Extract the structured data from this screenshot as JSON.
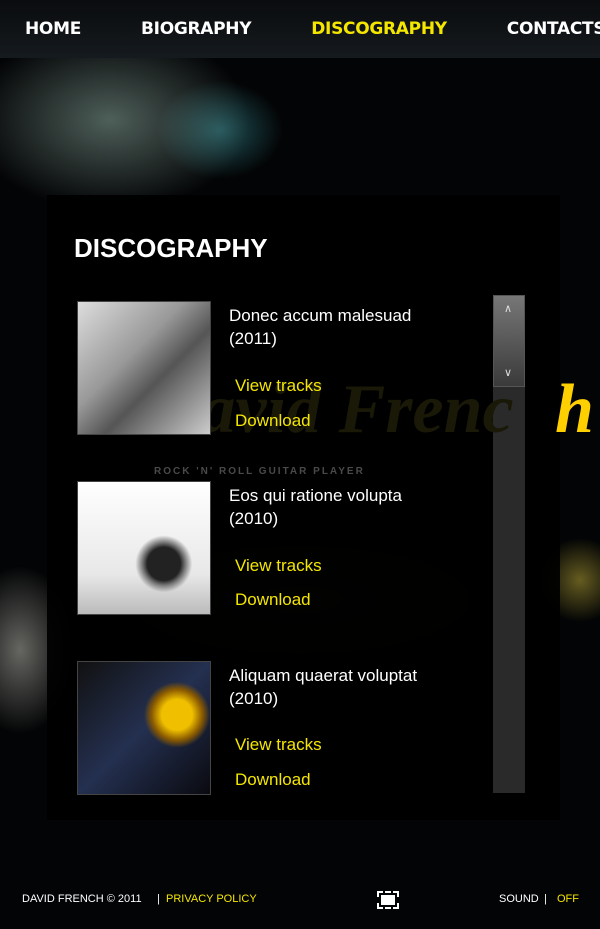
{
  "nav": {
    "items": [
      {
        "label": "HOME"
      },
      {
        "label": "BIOGRAPHY"
      },
      {
        "label": "DISCOGRAPHY",
        "active": true
      },
      {
        "label": "CONTACTS"
      }
    ]
  },
  "logo": {
    "text": "David French",
    "tagline": "ROCK 'N' ROLL GUITAR PLAYER"
  },
  "page": {
    "title": "DISCOGRAPHY"
  },
  "albums": [
    {
      "title": "Donec accum malesuad",
      "year": "(2011)",
      "view": "View tracks",
      "download": "Download",
      "image": "guitar-sheet-music"
    },
    {
      "title": "Eos qui ratione volupta",
      "year": "(2010)",
      "view": "View tracks",
      "download": "Download",
      "image": "headphones"
    },
    {
      "title": "Aliquam quaerat voluptat",
      "year": "(2010)",
      "view": "View tracks",
      "download": "Download",
      "image": "music-notes-globe"
    }
  ],
  "footer": {
    "copyright": "DAVID FRENCH © 2011",
    "sep": "|",
    "privacy": "PRIVACY POLICY",
    "sound": "SOUND",
    "sound_sep": "|",
    "sound_state": "OFF"
  },
  "colors": {
    "accent": "#f5e600",
    "background": "#000000"
  }
}
